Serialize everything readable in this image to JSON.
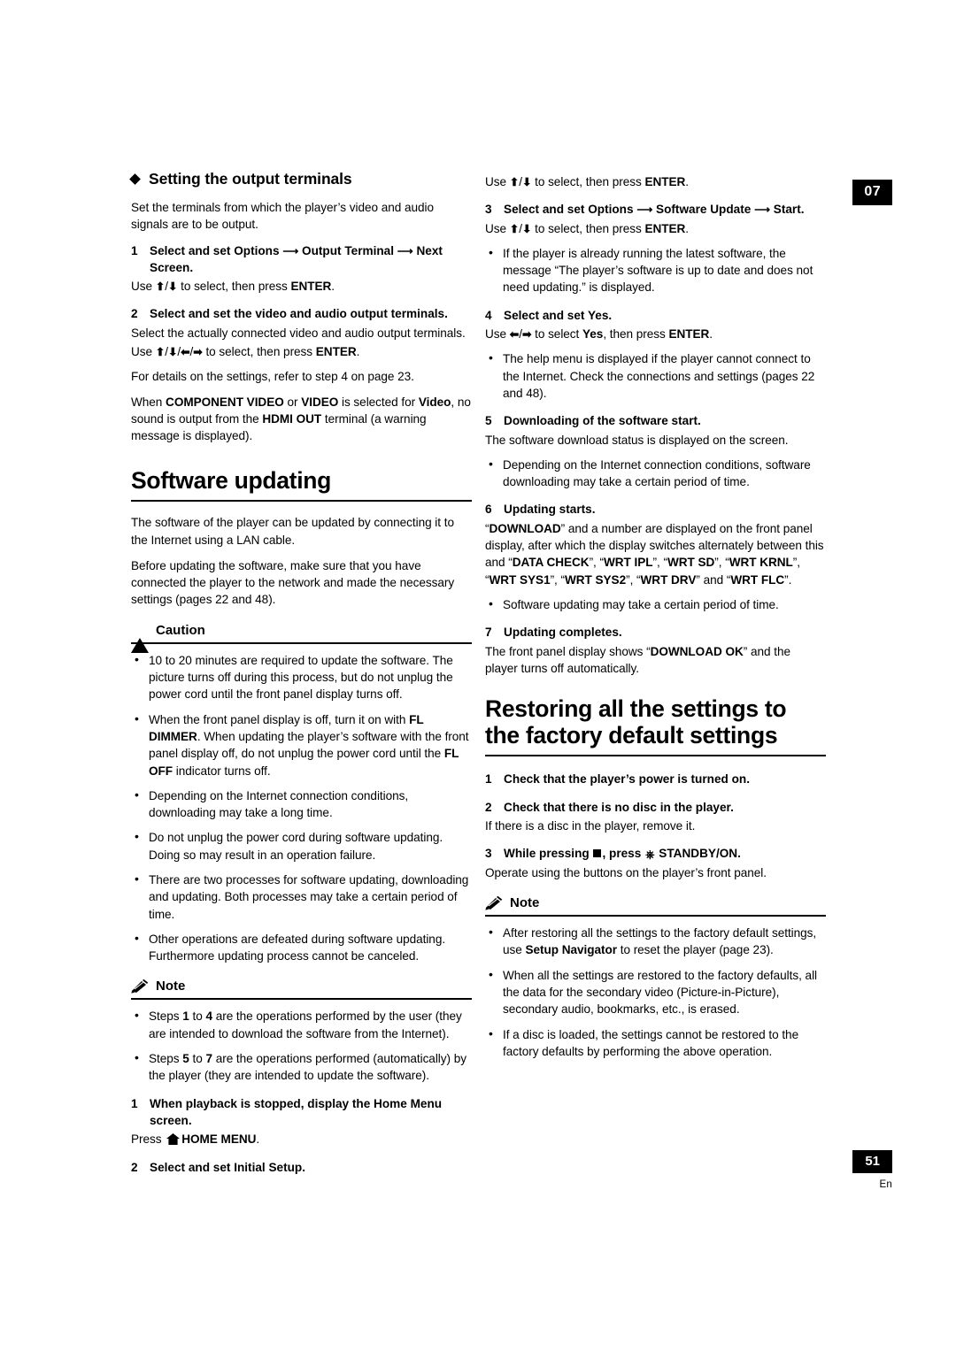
{
  "chapter_tab": "07",
  "page_number": "51",
  "page_lang": "En",
  "left_column": {
    "heading": "Setting the output terminals",
    "intro": "Set the terminals from which the player’s video and audio signals are to be output.",
    "step1_num": "1",
    "step1_text": "Select and set Options  Output Terminal  Next Screen.",
    "step1_use": "Use  /  to select, then press ENTER.",
    "step2_num": "2",
    "step2_text": "Select and set the video and audio output terminals.",
    "step2_body": "Select the actually connected video and audio output terminals.",
    "step2_use": "Use  /  /  /  to select, then press ENTER.",
    "step2_details": "For details on the settings, refer to step 4 on page 23.",
    "step2_note": "When COMPONENT VIDEO or VIDEO is selected for Video, no sound is output from the HDMI OUT terminal (a warning message is displayed).",
    "software_heading": "Software updating",
    "software_p1": "The software of the player can be updated by connecting it to the Internet using a LAN cable.",
    "software_p2": "Before updating the software, make sure that you have connected the player to the network and made the necessary settings (pages 22 and 48).",
    "caution_label": "Caution",
    "caution_bullets": [
      "10 to 20 minutes are required to update the software. The picture turns off during this process, but do not unplug the power cord until the front panel display turns off.",
      "When the front panel display is off, turn it on with FL DIMMER. When updating the player’s software with the front panel display off, do not unplug the power cord until the FL OFF indicator turns off.",
      "Depending on the Internet connection conditions, downloading may take a long time.",
      "Do not unplug the power cord during software updating. Doing so may result in an operation failure.",
      "There are two processes for software updating, downloading and updating. Both processes may take a certain period of time.",
      "Other operations are defeated during software updating. Furthermore updating process cannot be canceled."
    ],
    "note_label": "Note",
    "note_bullets": [
      "Steps 1 to 4 are the operations performed by the user (they are intended to download the software from the Internet).",
      "Steps 5 to 7 are the operations performed (automatically) by the player (they are intended to update the software)."
    ],
    "step_home_num": "1",
    "step_home_text": "When playback is stopped, display the Home Menu screen.",
    "step_home_press_pre": "Press",
    "step_home_press_label": "HOME MENU",
    "step_home_press_post": ".",
    "step_initial_num": "2",
    "step_initial_text": "Select and set Initial Setup."
  },
  "right_column": {
    "use_enter_top": "Use  /  to select, then press ENTER.",
    "step3_num": "3",
    "step3_text": "Select and set Options  Software Update  Start.",
    "step3_use": "Use  /  to select, then press ENTER.",
    "step3_bullet": "If the player is already running the latest software, the message “The player’s software is up to date and does not need updating.” is displayed.",
    "step4_num": "4",
    "step4_text": "Select and set Yes.",
    "step4_use": "Use  /  to select Yes, then press ENTER.",
    "step4_bullet": "The help menu is displayed if the player cannot connect to the Internet. Check the connections and settings (pages 22 and 48).",
    "step5_num": "5",
    "step5_text": "Downloading of the software start.",
    "step5_body": "The software download status is displayed on the screen.",
    "step5_bullet": "Depending on the Internet connection conditions, software downloading may take a certain period of time.",
    "step6_num": "6",
    "step6_text": "Updating starts.",
    "step6_body": "“DOWNLOAD” and a number are displayed on the front panel display, after which the display switches alternately between this and “DATA CHECK”, “WRT IPL”, “WRT SD”, “WRT KRNL”, “WRT SYS1”, “WRT SYS2”, “WRT DRV” and “WRT FLC”.",
    "step6_bullet": "Software updating may take a certain period of time.",
    "step7_num": "7",
    "step7_text": "Updating completes.",
    "step7_body": "The front panel display shows “DOWNLOAD OK” and the player turns off automatically.",
    "restore_heading": "Restoring all the settings to the factory default settings",
    "r_step1_num": "1",
    "r_step1_text": "Check that the player’s power is turned on.",
    "r_step2_num": "2",
    "r_step2_text": "Check that there is no disc in the player.",
    "r_step2_body": "If there is a disc in the player, remove it.",
    "r_step3_num": "3",
    "r_step3_text": "While pressing  , press  STANDBY/ON.",
    "r_step3_body": "Operate using the buttons on the player’s front panel.",
    "note_label": "Note",
    "note_bullets": [
      "After restoring all the settings to the factory default settings, use Setup Navigator to reset the player (page 23).",
      "When all the settings are restored to the factory defaults, all the data for the secondary video (Picture-in-Picture), secondary audio, bookmarks, etc., is erased.",
      "If a disc is loaded, the settings cannot be restored to the factory defaults by performing the above operation."
    ]
  }
}
